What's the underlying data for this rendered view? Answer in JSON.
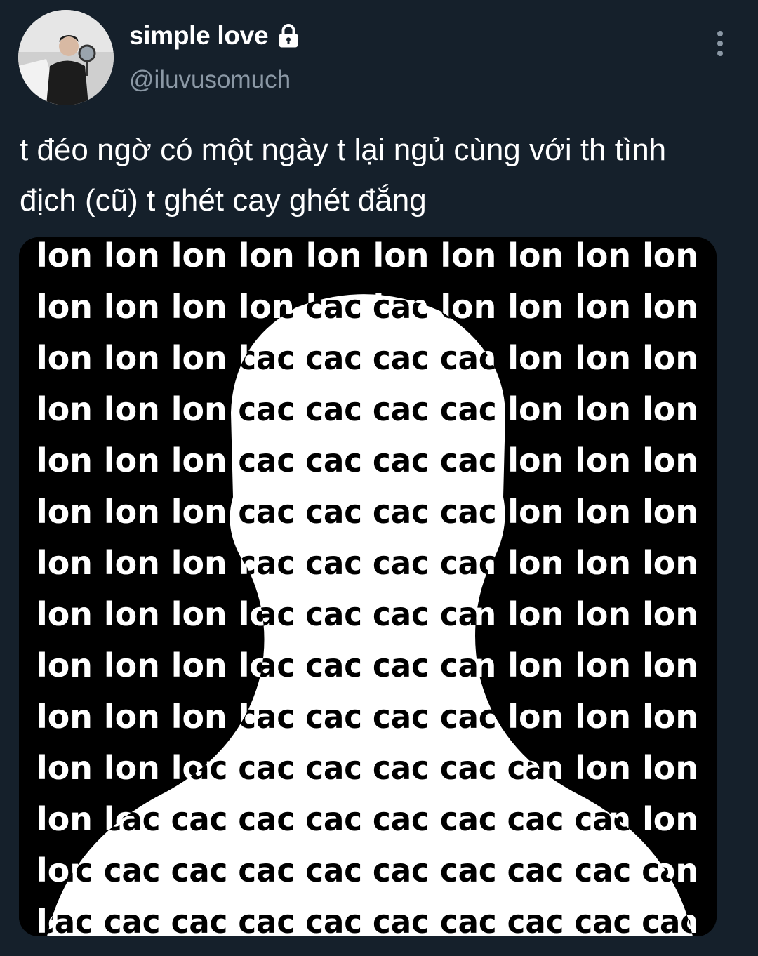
{
  "post": {
    "display_name": "simple love",
    "handle": "@iluvusomuch",
    "text": "t đéo ngờ có một ngày t lại ngủ cùng với th tình địch (cũ) t ghét cay ghét đắng"
  },
  "icons": {
    "lock": "lock-icon",
    "more": "more-vertical-icon"
  },
  "colors": {
    "background": "#15202b",
    "secondary_text": "#8b98a5"
  },
  "media": {
    "outer_word": "lon",
    "inner_word": "cac"
  }
}
